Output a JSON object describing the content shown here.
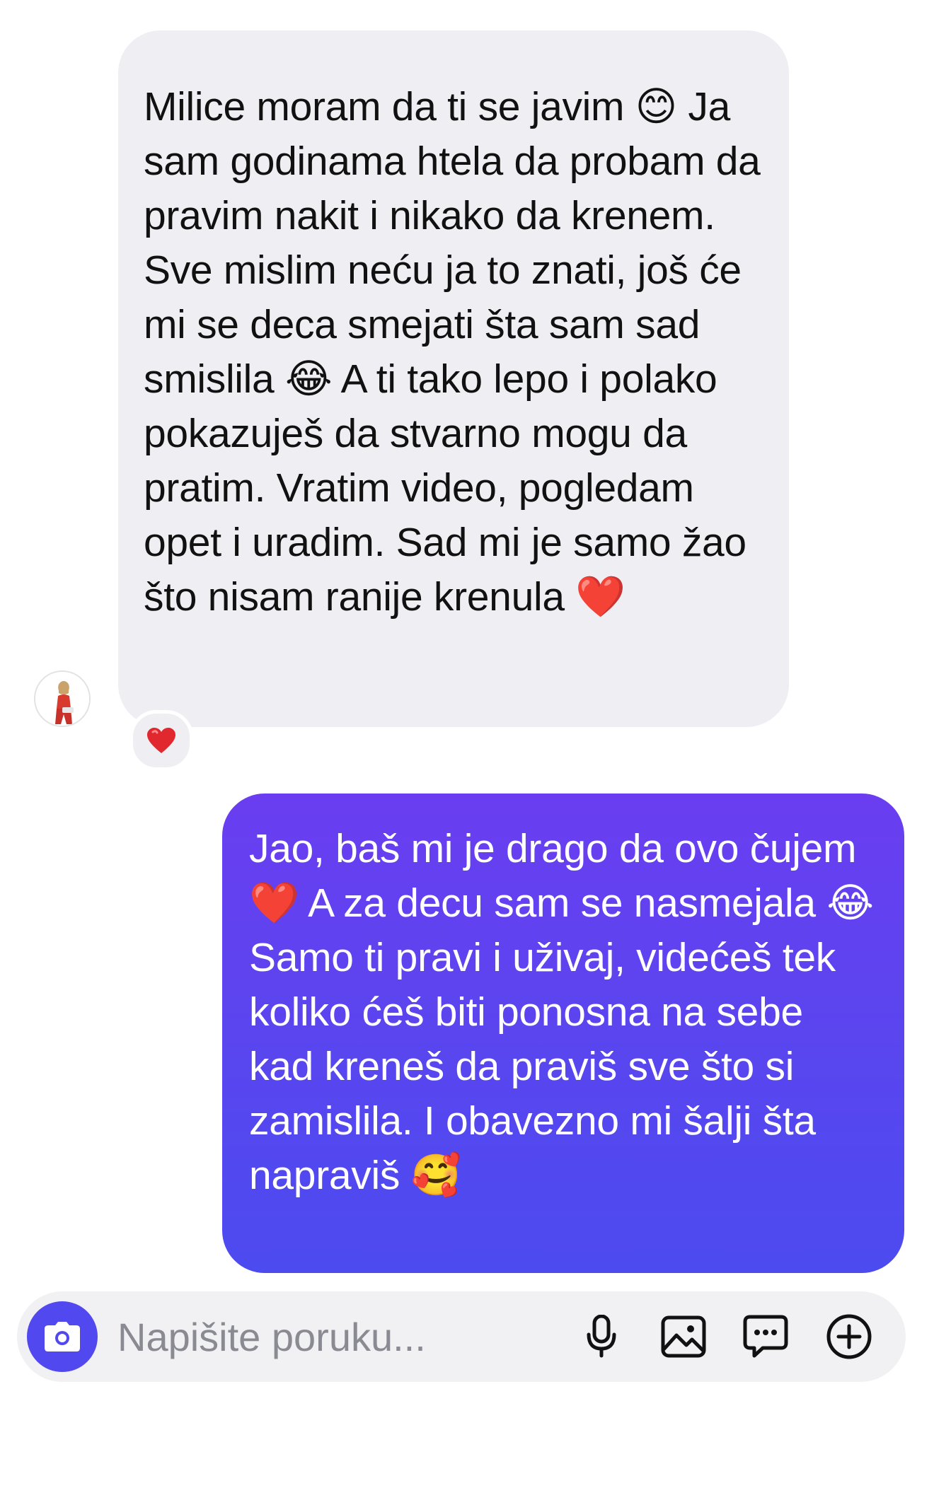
{
  "messages": [
    {
      "direction": "incoming",
      "text": "Milice moram da ti se javim 😊 Ja sam godinama htela da probam da pravim nakit i nikako da krenem. Sve mislim neću ja to znati, još će mi se deca smejati šta sam sad smislila 😂 A ti tako lepo i polako pokazuješ da stvarno mogu da pratim. Vratim video, pogledam opet i uradim. Sad mi je samo žao što nisam ranije krenula ❤️",
      "reaction": "❤️"
    },
    {
      "direction": "outgoing",
      "text": "Jao, baš mi je drago da ovo čujem ❤️ A za decu sam se nasmejala 😂 Samo ti pravi i uživaj, videćeš tek koliko ćeš biti ponosna na sebe kad kreneš da praviš sve što si zamislila. I obavezno mi šalji šta napraviš 🥰"
    }
  ],
  "composer": {
    "placeholder": "Napišite poruku...",
    "value": "",
    "camera_icon": "camera-icon",
    "mic_icon": "microphone-icon",
    "image_icon": "image-icon",
    "sticker_icon": "chat-bubble-icon",
    "add_icon": "plus-circle-icon"
  },
  "colors": {
    "incoming_bubble": "#efeff3",
    "outgoing_bubble_top": "#6a3ef0",
    "outgoing_bubble_bottom": "#4c4bf0",
    "accent": "#5148f0",
    "reaction_heart": "#e0282e"
  }
}
